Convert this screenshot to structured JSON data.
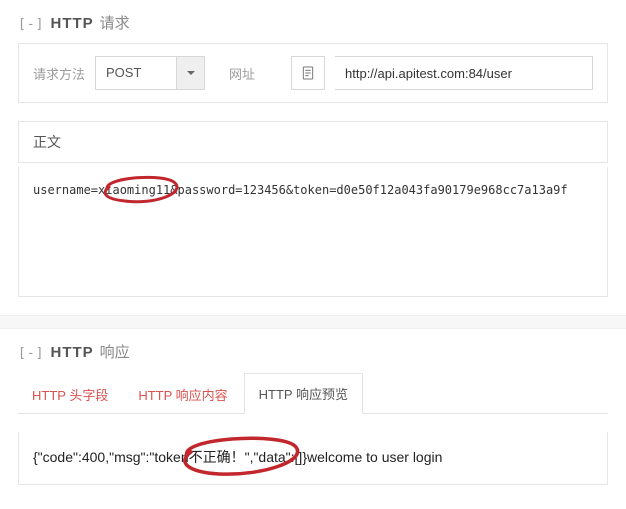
{
  "requestSection": {
    "toggle": "[-]",
    "label1": "HTTP",
    "label2": "请求"
  },
  "requestForm": {
    "methodLabel": "请求方法",
    "methodValue": "POST",
    "urlLabel": "网址",
    "urlValue": "http://api.apitest.com:84/user"
  },
  "bodySection": {
    "label": "正文",
    "content": "username=xiaoming11&password=123456&token=d0e50f12a043fa90179e968cc7a13a9f"
  },
  "responseSection": {
    "toggle": "[-]",
    "label1": "HTTP",
    "label2": "响应"
  },
  "tabs": {
    "headers": "HTTP 头字段",
    "content": "HTTP 响应内容",
    "preview": "HTTP 响应预览"
  },
  "responsePreview": "{\"code\":400,\"msg\":\"token不正确！\",\"data\":[]}welcome to user login"
}
